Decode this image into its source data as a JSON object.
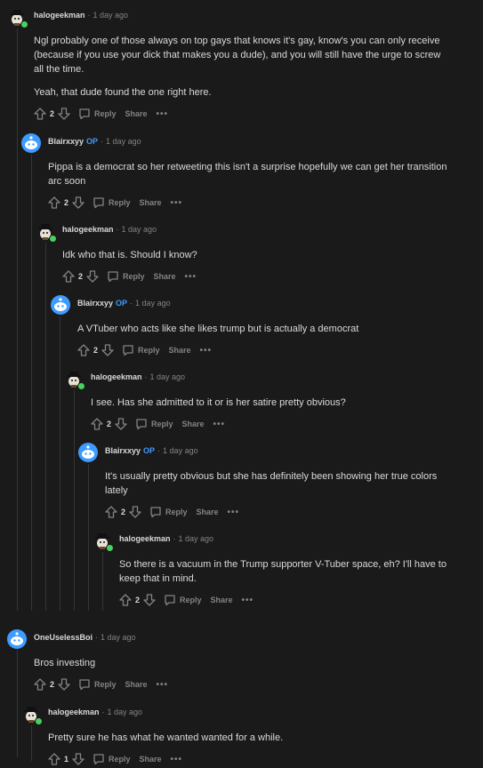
{
  "actions": {
    "reply": "Reply",
    "share": "Share",
    "more": "•••"
  },
  "comments": [
    {
      "user": "halogeekman",
      "op": "",
      "time": "1 day ago",
      "paragraphs": [
        "Ngl probably one of those always on top gays that knows it's gay, know's you can only receive (because if you use your dick that makes you a dude), and you will still have the urge to screw all the time.",
        "Yeah, that dude found the one right here."
      ],
      "score": "2",
      "avatar": "snoo-hat-avatar",
      "online": true
    },
    {
      "user": "Blairxxyy",
      "op": "OP",
      "time": "1 day ago",
      "paragraphs": [
        "Pippa is a democrat so her retweeting this isn't a surprise hopefully we can get her transition arc soon"
      ],
      "score": "2",
      "avatar": "snoo-default-avatar",
      "online": false
    },
    {
      "user": "halogeekman",
      "op": "",
      "time": "1 day ago",
      "paragraphs": [
        "Idk who that is. Should I know?"
      ],
      "score": "2",
      "avatar": "snoo-hat-avatar",
      "online": true
    },
    {
      "user": "Blairxxyy",
      "op": "OP",
      "time": "1 day ago",
      "paragraphs": [
        "A VTuber who acts like she likes trump but is actually a democrat"
      ],
      "score": "2",
      "avatar": "snoo-default-avatar",
      "online": false
    },
    {
      "user": "halogeekman",
      "op": "",
      "time": "1 day ago",
      "paragraphs": [
        "I see. Has she admitted to it or is her satire pretty obvious?"
      ],
      "score": "2",
      "avatar": "snoo-hat-avatar",
      "online": true
    },
    {
      "user": "Blairxxyy",
      "op": "OP",
      "time": "1 day ago",
      "paragraphs": [
        "It's usually pretty obvious but she has definitely been showing her true colors lately"
      ],
      "score": "2",
      "avatar": "snoo-default-avatar",
      "online": false
    },
    {
      "user": "halogeekman",
      "op": "",
      "time": "1 day ago",
      "paragraphs": [
        "So there is a vacuum in the Trump supporter V-Tuber space, eh? I'll have to keep that in mind."
      ],
      "score": "2",
      "avatar": "snoo-hat-avatar",
      "online": true
    },
    {
      "user": "OneUselessBoi",
      "op": "",
      "time": "1 day ago",
      "paragraphs": [
        "Bros investing"
      ],
      "score": "2",
      "avatar": "snoo-default-avatar",
      "online": false
    },
    {
      "user": "halogeekman",
      "op": "",
      "time": "1 day ago",
      "paragraphs": [
        "Pretty sure he has what he wanted wanted for a while."
      ],
      "score": "1",
      "avatar": "snoo-hat-avatar",
      "online": true
    }
  ]
}
